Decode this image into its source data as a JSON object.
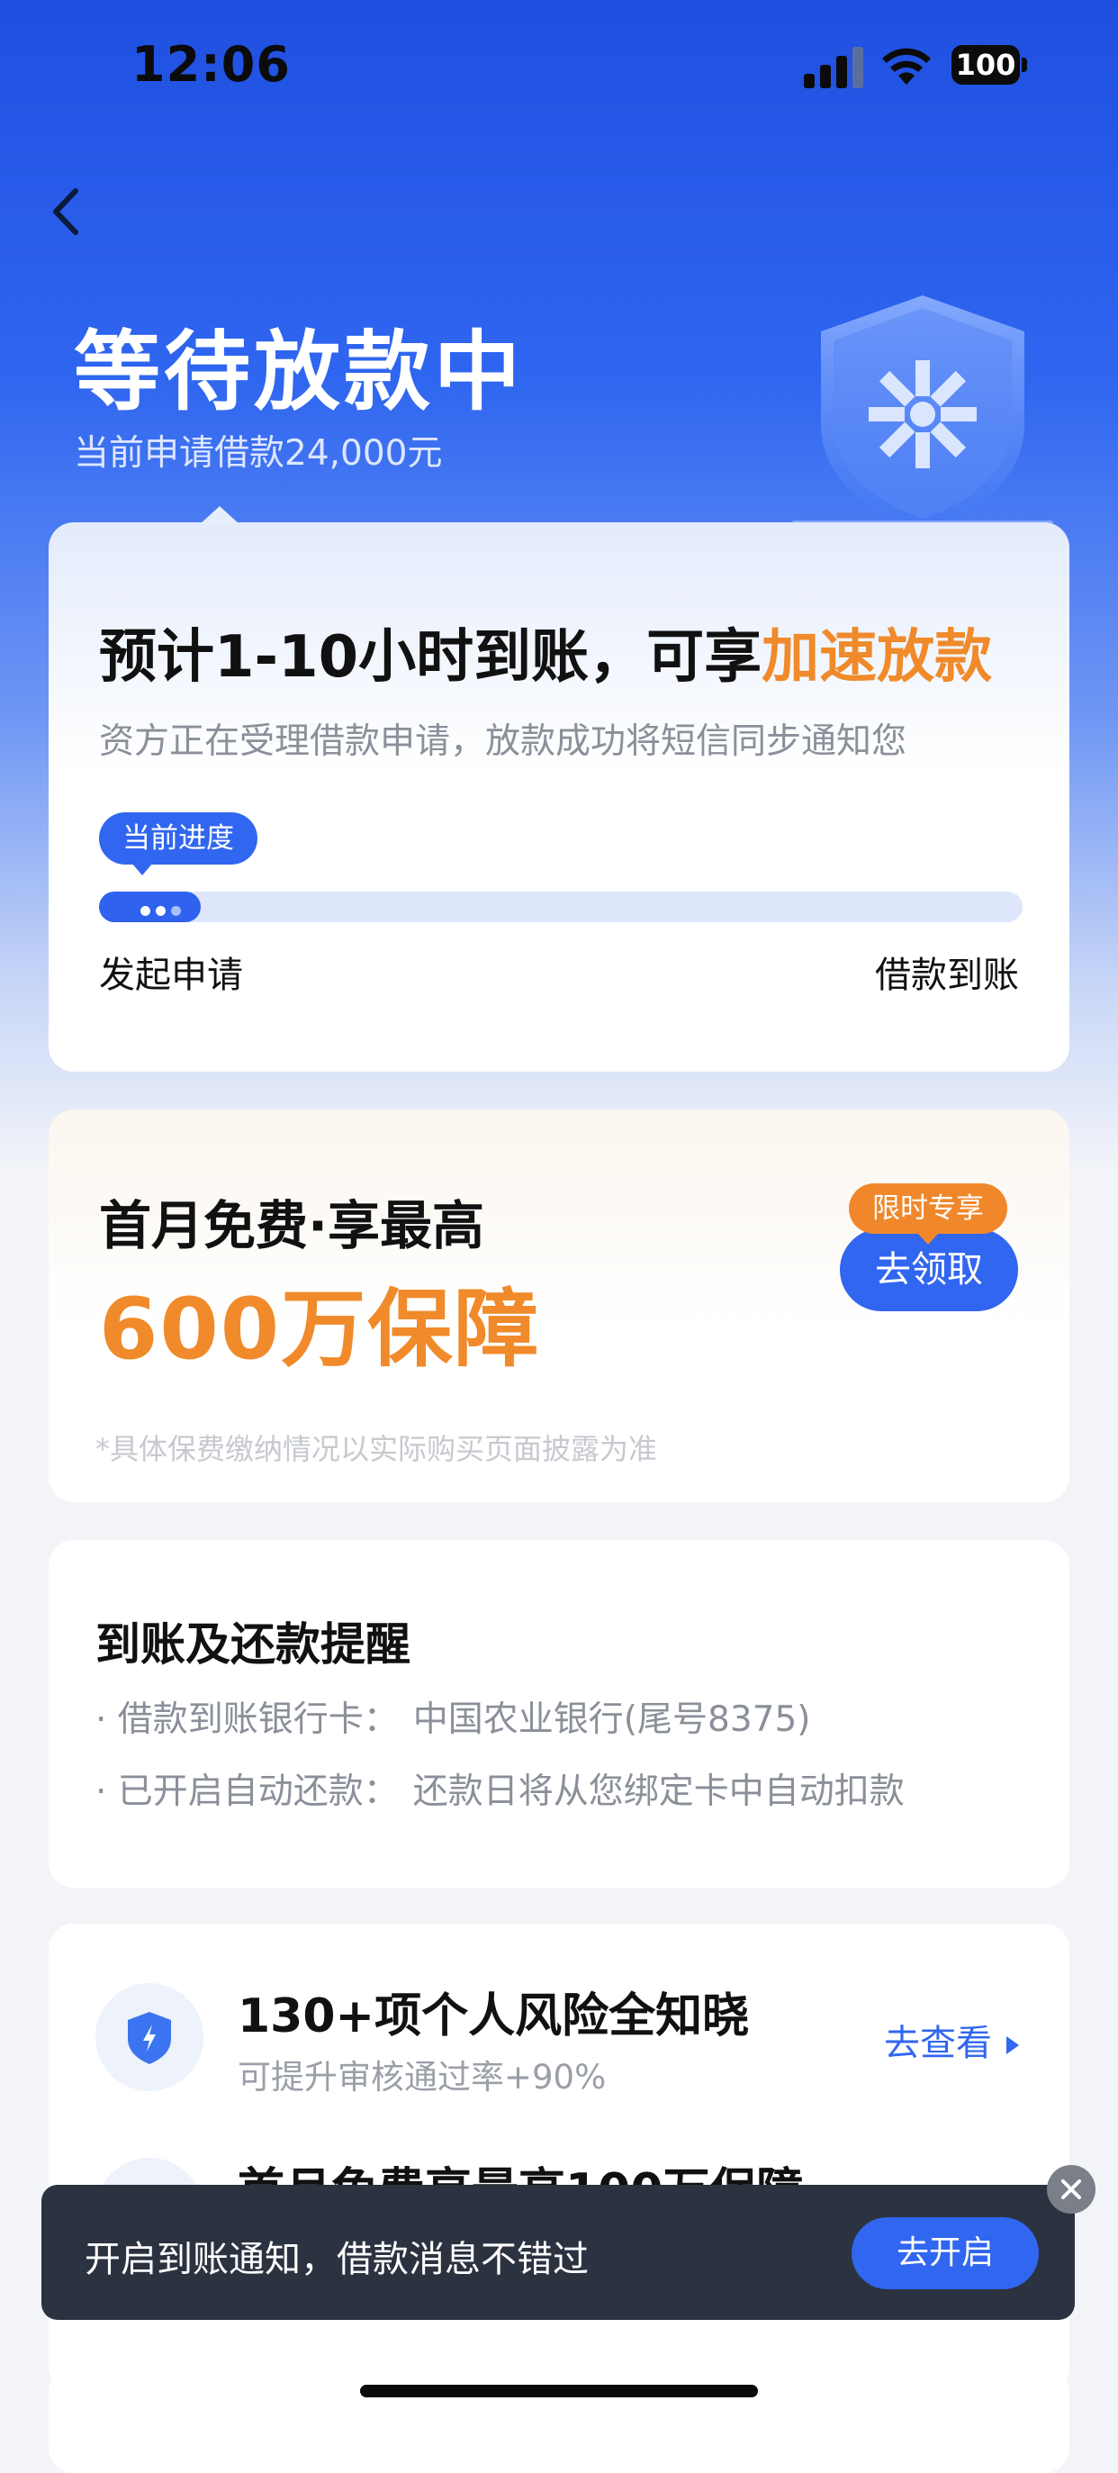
{
  "status_bar": {
    "time": "12:06",
    "battery": "100"
  },
  "header": {
    "title": "等待放款中",
    "subtitle": "当前申请借款24,000元"
  },
  "progress_card": {
    "estimate_prefix": "预计1-10小时到账，可享",
    "estimate_highlight": "加速放款",
    "description": "资方正在受理借款申请，放款成功将短信同步通知您",
    "progress_tip": "当前进度",
    "progress_fraction": 0.11,
    "step_start": "发起申请",
    "step_end": "借款到账"
  },
  "insurance_card": {
    "line1": "首月免费·享最高",
    "amount": "600万保障",
    "badge": "限时专享",
    "button": "去领取",
    "note": "*具体保费缴纳情况以实际购买页面披露为准"
  },
  "reminder_card": {
    "title": "到账及还款提醒",
    "rows": [
      {
        "label": "· 借款到账银行卡：",
        "value": "中国农业银行(尾号8375)"
      },
      {
        "label": "· 已开启自动还款：",
        "value": "还款日将从您绑定卡中自动扣款"
      }
    ]
  },
  "risk_card": {
    "item1_title": "130+项个人风险全知晓",
    "item1_sub": "可提升审核通过率+90%",
    "item1_link": "去查看",
    "item2_title": "首月免费享最高100万保障"
  },
  "toast": {
    "text": "开启到账通知，借款消息不错过",
    "button": "去开启"
  },
  "colors": {
    "primary": "#3166f0",
    "accent_orange": "#f08a2a",
    "header_blue": "#1f4fe0"
  }
}
